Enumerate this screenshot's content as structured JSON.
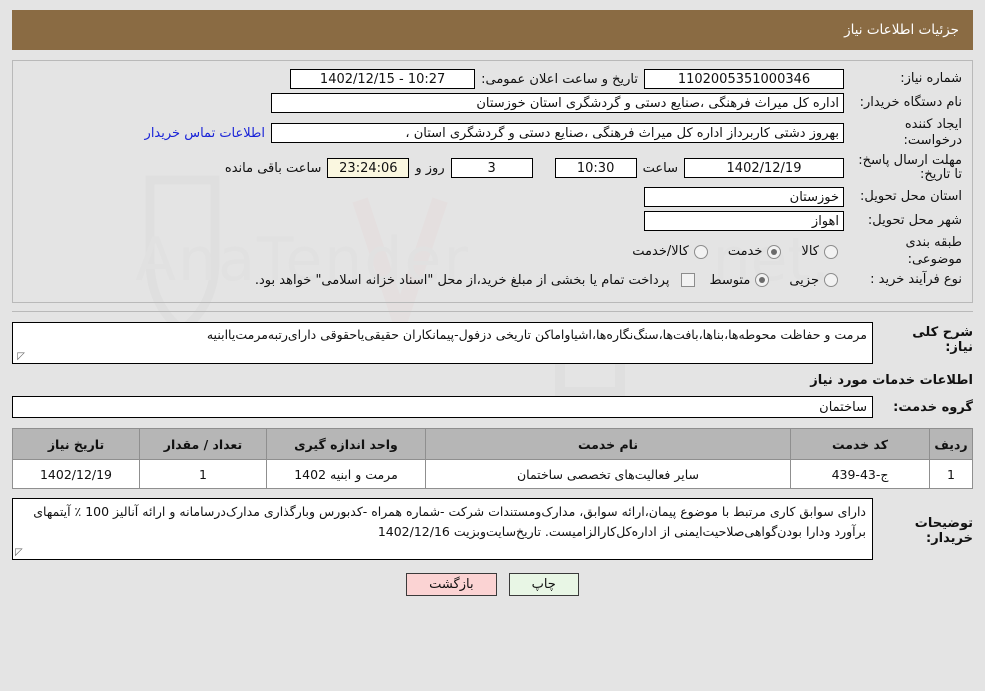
{
  "header": {
    "title": "جزئیات اطلاعات نیاز"
  },
  "form": {
    "need_number_label": "شماره نیاز:",
    "need_number_value": "1102005351000346",
    "announce_label": "تاریخ و ساعت اعلان عمومی:",
    "announce_value": "10:27 - 1402/12/15",
    "buyer_org_label": "نام دستگاه خریدار:",
    "buyer_org_value": "اداره کل میراث فرهنگی ،صنایع دستی و گردشگری استان خوزستان",
    "requester_label": "ایجاد کننده درخواست:",
    "requester_value": "بهروز دشتی کاربرداز اداره کل میراث فرهنگی ،صنایع دستی و گردشگری استان ،",
    "contact_link": "اطلاعات تماس خریدار",
    "deadline_label": "مهلت ارسال پاسخ: تا تاریخ:",
    "deadline_date": "1402/12/19",
    "deadline_hour_label": "ساعت",
    "deadline_hour": "10:30",
    "days_remaining": "3",
    "days_word": "روز و",
    "countdown": "23:24:06",
    "countdown_suffix": "ساعت باقی مانده",
    "province_label": "استان محل تحویل:",
    "province_value": "خوزستان",
    "city_label": "شهر محل تحویل:",
    "city_value": "اهواز",
    "category_label": "طبقه بندی موضوعی:",
    "category_options": [
      {
        "label": "کالا",
        "selected": false
      },
      {
        "label": "خدمت",
        "selected": true
      },
      {
        "label": "کالا/خدمت",
        "selected": false
      }
    ],
    "process_label": "نوع فرآیند خرید :",
    "process_options": [
      {
        "label": "جزیی",
        "selected": false
      },
      {
        "label": "متوسط",
        "selected": true
      }
    ],
    "treasury_checkbox_checked": false,
    "treasury_text": "پرداخت تمام یا بخشی از مبلغ خرید،از محل \"اسناد خزانه اسلامی\" خواهد بود."
  },
  "description": {
    "label": "شرح کلی نیاز:",
    "value": "مرمت و حفاظت محوطه‌ها،بناها،بافت‌ها،سنگ‌نگاره‌ها،اشیاواماکن تاریخی دزفول-پیمانکاران حقیقی‌یاحقوقی دارای‌رتبه‌مرمت‌یاابنیه"
  },
  "services": {
    "section_title": "اطلاعات خدمات مورد نیاز",
    "group_label": "گروه خدمت:",
    "group_value": "ساختمان",
    "columns": [
      "ردیف",
      "کد خدمت",
      "نام خدمت",
      "واحد اندازه گیری",
      "تعداد / مقدار",
      "تاریخ نیاز"
    ],
    "rows": [
      {
        "row_no": "1",
        "service_code": "ج-43-439",
        "service_name": "سایر فعالیت‌های تخصصی ساختمان",
        "unit": "مرمت و ابنیه 1402",
        "quantity": "1",
        "need_date": "1402/12/19"
      }
    ]
  },
  "notes": {
    "label": "توضیحات خریدار:",
    "value": "دارای سوابق کاری مرتبط با موضوع پیمان،ارائه سوابق، مدارک‌ومستندات شرکت -شماره همراه -کدبورس وبارگذاری مدارک‌درسامانه و ارائه آنالیز 100 ٪ آیتمهای برآورد ودارا بودن‌گواهی‌صلاحیت‌ایمنی از اداره‌کل‌کارالزامیست. تاریخ‌سایت‌وبزیت 1402/12/16"
  },
  "buttons": {
    "print": "چاپ",
    "back": "بازگشت"
  },
  "colors": {
    "header_bg": "#8a6b43",
    "page_bg": "#e4e4e4",
    "link": "#1a24d8",
    "countdown_bg": "#faf7e0",
    "table_header_bg": "#b6b6b6",
    "print_btn_bg": "#e8f6e5",
    "back_btn_bg": "#fbd3d3"
  }
}
